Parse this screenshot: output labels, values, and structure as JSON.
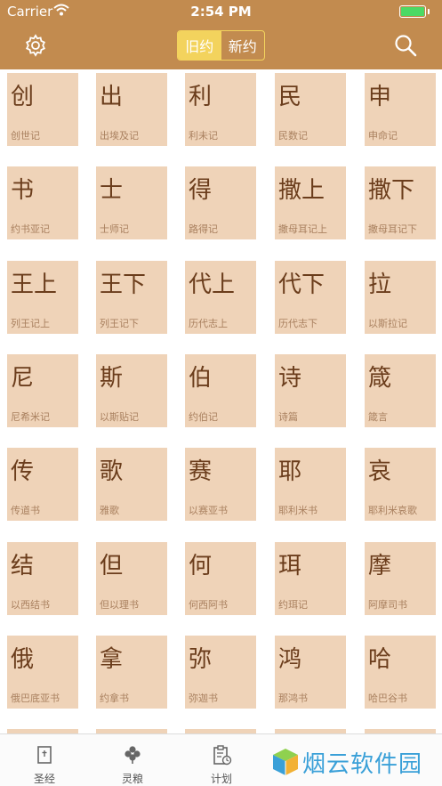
{
  "status": {
    "carrier": "Carrier",
    "time": "2:54 PM",
    "battery_level": 1.0
  },
  "nav": {
    "segments": [
      "旧约",
      "新约"
    ],
    "selected": 0,
    "colors": {
      "bar": "#c28b4f",
      "accent": "#f3d35d",
      "tile": "#efd3b8"
    }
  },
  "books": [
    {
      "abbr": "创",
      "name": "创世记"
    },
    {
      "abbr": "出",
      "name": "出埃及记"
    },
    {
      "abbr": "利",
      "name": "利未记"
    },
    {
      "abbr": "民",
      "name": "民数记"
    },
    {
      "abbr": "申",
      "name": "申命记"
    },
    {
      "abbr": "书",
      "name": "约书亚记"
    },
    {
      "abbr": "士",
      "name": "士师记"
    },
    {
      "abbr": "得",
      "name": "路得记"
    },
    {
      "abbr": "撒上",
      "name": "撒母耳记上"
    },
    {
      "abbr": "撒下",
      "name": "撒母耳记下"
    },
    {
      "abbr": "王上",
      "name": "列王记上"
    },
    {
      "abbr": "王下",
      "name": "列王记下"
    },
    {
      "abbr": "代上",
      "name": "历代志上"
    },
    {
      "abbr": "代下",
      "name": "历代志下"
    },
    {
      "abbr": "拉",
      "name": "以斯拉记"
    },
    {
      "abbr": "尼",
      "name": "尼希米记"
    },
    {
      "abbr": "斯",
      "name": "以斯贴记"
    },
    {
      "abbr": "伯",
      "name": "约伯记"
    },
    {
      "abbr": "诗",
      "name": "诗篇"
    },
    {
      "abbr": "箴",
      "name": "箴言"
    },
    {
      "abbr": "传",
      "name": "传道书"
    },
    {
      "abbr": "歌",
      "name": "雅歌"
    },
    {
      "abbr": "赛",
      "name": "以赛亚书"
    },
    {
      "abbr": "耶",
      "name": "耶利米书"
    },
    {
      "abbr": "哀",
      "name": "耶利米哀歌"
    },
    {
      "abbr": "结",
      "name": "以西结书"
    },
    {
      "abbr": "但",
      "name": "但以理书"
    },
    {
      "abbr": "何",
      "name": "何西阿书"
    },
    {
      "abbr": "珥",
      "name": "约珥记"
    },
    {
      "abbr": "摩",
      "name": "阿摩司书"
    },
    {
      "abbr": "俄",
      "name": "俄巴底亚书"
    },
    {
      "abbr": "拿",
      "name": "约拿书"
    },
    {
      "abbr": "弥",
      "name": "弥迦书"
    },
    {
      "abbr": "鸿",
      "name": "那鸿书"
    },
    {
      "abbr": "哈",
      "name": "哈巴谷书"
    }
  ],
  "tabs": [
    {
      "label": "圣经",
      "icon": "bible-icon"
    },
    {
      "label": "灵粮",
      "icon": "clover-icon"
    },
    {
      "label": "计划",
      "icon": "clipboard-clock-icon"
    }
  ],
  "watermark": {
    "text": "烟云软件园",
    "icon": "cube-logo-icon"
  }
}
